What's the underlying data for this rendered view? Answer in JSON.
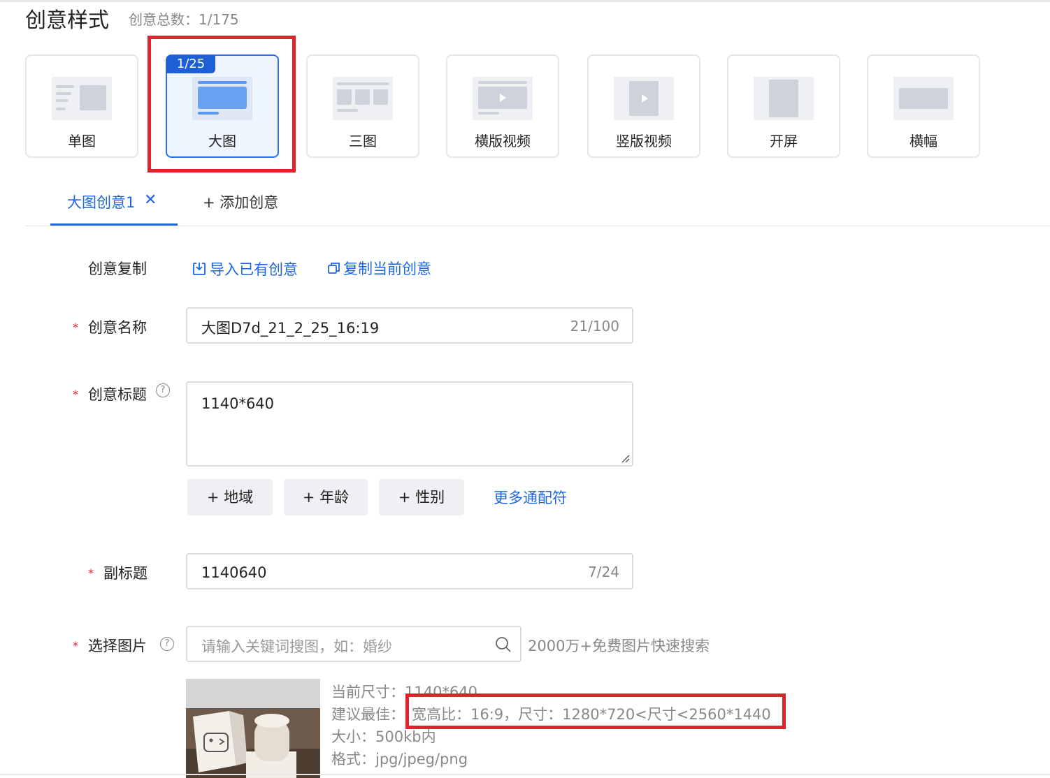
{
  "header": {
    "title": "创意样式",
    "count_label": "创意总数：1/175"
  },
  "styles": [
    {
      "label": "单图"
    },
    {
      "label": "大图",
      "badge": "1/25",
      "selected": true
    },
    {
      "label": "三图"
    },
    {
      "label": "横版视频"
    },
    {
      "label": "竖版视频"
    },
    {
      "label": "开屏"
    },
    {
      "label": "横幅"
    }
  ],
  "tabs": {
    "active_label": "大图创意1",
    "close_glyph": "✕",
    "add_label": "+ 添加创意"
  },
  "form": {
    "copy": {
      "label": "创意复制",
      "import_link": "导入已有创意",
      "duplicate_link": "复制当前创意"
    },
    "name": {
      "label": "创意名称",
      "value": "大图D7d_21_2_25_16:19",
      "counter": "21/100"
    },
    "title": {
      "label": "创意标题",
      "value": "1140*640"
    },
    "wildcards": {
      "buttons": [
        "+ 地域",
        "+ 年龄",
        "+ 性别"
      ],
      "more_link": "更多通配符"
    },
    "subtitle": {
      "label": "副标题",
      "value": "1140640",
      "counter": "7/24"
    },
    "image": {
      "label": "选择图片",
      "search_placeholder": "请输入关键词搜图，如：婚纱",
      "search_hint": "2000万+免费图片快速搜索",
      "current_size": "当前尺寸：1140*640",
      "recommend_prefix": "建议最佳：",
      "recommend_value": "宽高比：16:9，尺寸：1280*720<尺寸<2560*1440",
      "file_size": "大小：500kb内",
      "format": "格式：jpg/jpeg/png"
    }
  },
  "colors": {
    "accent": "#1f66dc",
    "highlight": "#e0222c",
    "required": "#e0222c"
  }
}
